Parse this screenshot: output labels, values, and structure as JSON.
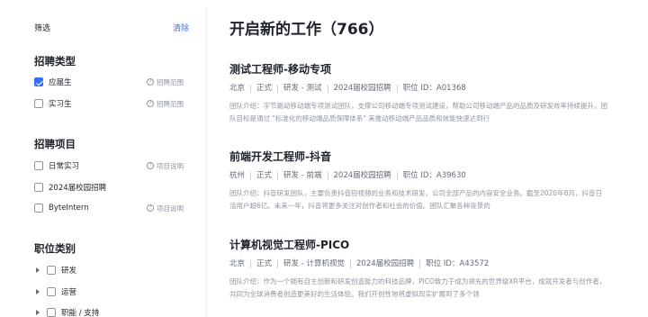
{
  "sidebar": {
    "filter_title": "筛选",
    "clear_label": "清除",
    "sections": {
      "type": {
        "title": "招聘类型",
        "options": [
          {
            "label": "应届生",
            "checked": true,
            "help": "招聘范围"
          },
          {
            "label": "实习生",
            "checked": false,
            "help": "招聘范围"
          }
        ]
      },
      "project": {
        "title": "招聘项目",
        "options": [
          {
            "label": "日常实习",
            "checked": false,
            "help": "项目说明"
          },
          {
            "label": "2024届校园招聘",
            "checked": false,
            "help": ""
          },
          {
            "label": "ByteIntern",
            "checked": false,
            "help": "项目说明"
          }
        ]
      },
      "category": {
        "title": "职位类别",
        "options": [
          {
            "label": "研发"
          },
          {
            "label": "运营"
          },
          {
            "label": "职能 / 支持"
          }
        ]
      }
    },
    "help_icon_glyph": "?"
  },
  "main": {
    "title": "开启新的工作（766）",
    "jobs": [
      {
        "title": "测试工程师-移动专项",
        "city": "北京",
        "type": "正式",
        "category": "研发 - 测试",
        "project": "2024届校园招聘",
        "job_id": "职位 ID：A01368",
        "desc": "团队介绍：字节跳动移动端专项测试团队，支撑公司移动端专项测试建设，帮助公司移动端产品的品质及研发效率持续提升。团队目标是通过 \"标准化的移动端品质保障体系\" 来推动移动端产品品质和效能快速达到行"
      },
      {
        "title": "前端开发工程师-抖音",
        "city": "杭州",
        "type": "正式",
        "category": "研发 - 前端",
        "project": "2024届校园招聘",
        "job_id": "职位 ID：A39630",
        "desc": "团队介绍：抖音研发团队，主要负责抖音短视频的业务和技术研发，公司全部产品的内容安全业务。截至2020年8月，抖音日活用户超6亿。未来一年，抖音将更多关注对创作者和社会的价值。团队汇聚各种背景的"
      },
      {
        "title": "计算机视觉工程师-PICO",
        "city": "北京",
        "type": "正式",
        "category": "研发 - 计算机视觉",
        "project": "2024届校园招聘",
        "job_id": "职位 ID：A43572",
        "desc": "团队介绍：作为一个拥有自主创新和研发创造能力的科技品牌，PICO致力于成为领先的世界级XR平台，成就开发者与创作者，共同为全球消费者创造更美好的生活体验。我们开创性地将虚拟现实扩展到了多个领"
      }
    ]
  },
  "colors": {
    "accent": "#3370ff",
    "text": "#1f2329",
    "muted": "#8f959e"
  }
}
